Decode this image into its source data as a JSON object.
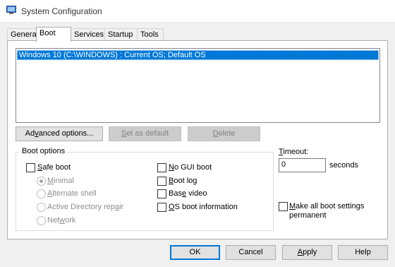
{
  "window": {
    "title": "System Configuration",
    "icon": "msconfig-app-icon"
  },
  "tabs": [
    {
      "label": "General",
      "active": false
    },
    {
      "label": "Boot",
      "active": true
    },
    {
      "label": "Services",
      "active": false
    },
    {
      "label": "Startup",
      "active": false
    },
    {
      "label": "Tools",
      "active": false
    }
  ],
  "os_list": {
    "items": [
      {
        "label": "Windows 10 (C:\\WINDOWS) : Current OS; Default OS",
        "selected": true
      }
    ]
  },
  "list_buttons": {
    "advanced": {
      "label": "Advanced options...",
      "enabled": true
    },
    "set_default": {
      "label": "Set as default",
      "enabled": false
    },
    "delete": {
      "label": "Delete",
      "enabled": false
    }
  },
  "boot_options": {
    "title": "Boot options",
    "safe_boot": {
      "label": "Safe boot",
      "checked": false
    },
    "safe_modes": [
      {
        "label": "Minimal",
        "checked": true,
        "enabled": false
      },
      {
        "label": "Alternate shell",
        "checked": false,
        "enabled": false
      },
      {
        "label": "Active Directory repair",
        "checked": false,
        "enabled": false
      },
      {
        "label": "Network",
        "checked": false,
        "enabled": false
      }
    ],
    "right_options": [
      {
        "label": "No GUI boot",
        "checked": false
      },
      {
        "label": "Boot log",
        "checked": false
      },
      {
        "label": "Base video",
        "checked": false
      },
      {
        "label": "OS boot information",
        "checked": false
      }
    ]
  },
  "timeout": {
    "label": "Timeout:",
    "value": "0",
    "unit": "seconds"
  },
  "make_permanent": {
    "label_line1": "Make all boot settings",
    "label_line2": "permanent",
    "checked": false
  },
  "footer": {
    "ok": "OK",
    "cancel": "Cancel",
    "apply": "Apply",
    "help": "Help"
  },
  "colors": {
    "selection": "#0078d7",
    "window_bg": "#f0f0f0",
    "panel_bg": "#ffffff"
  }
}
